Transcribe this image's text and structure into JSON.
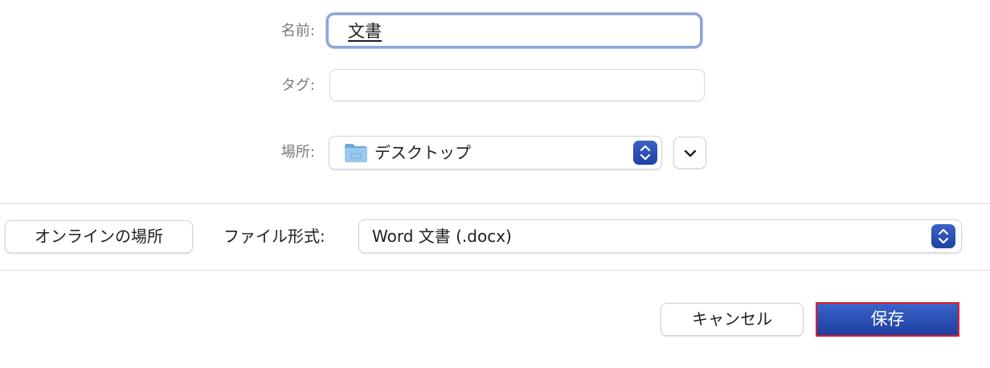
{
  "save_dialog": {
    "name_label": "名前:",
    "name_value": "文書",
    "tag_label": "タグ:",
    "tag_value": "",
    "location_label": "場所:",
    "location_value": "デスクトップ",
    "online_button_label": "オンラインの場所",
    "format_label": "ファイル形式:",
    "format_value": "Word 文書 (.docx)",
    "cancel_label": "キャンセル",
    "save_label": "保存"
  },
  "icons": {
    "location_icon": "folder-icon",
    "location_stepper": "up-down-arrows-icon",
    "expand_icon": "chevron-down-icon",
    "format_stepper": "up-down-arrows-icon"
  },
  "colors": {
    "accent": "#2b4fb1",
    "focus_ring": "#8fa5d6",
    "highlight_outline": "#e0202a",
    "label_gray": "#7a7a7a"
  }
}
